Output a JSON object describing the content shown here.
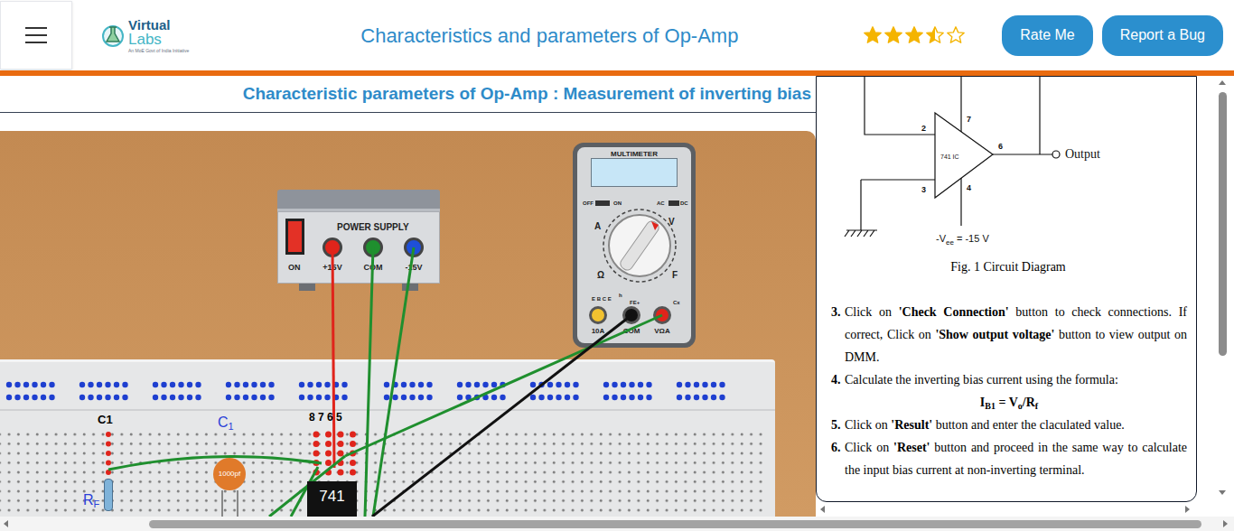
{
  "logo": {
    "word1": "Virtual",
    "word2": "Labs",
    "tagline": "An MoE Govt of India Initiative"
  },
  "title": "Characteristics and parameters of Op-Amp",
  "rating": {
    "stars": 3.5,
    "max": 5
  },
  "buttons": [
    "Rate Me",
    "Report a Bug"
  ],
  "experiment_heading": "Characteristic parameters of Op-Amp : Measurement of inverting bias",
  "power_supply": {
    "title": "POWER SUPPLY",
    "switch_label": "ON",
    "on": true,
    "terminals": [
      {
        "label": "+15V",
        "color": "#e0241b"
      },
      {
        "label": "COM",
        "color": "#1f8f2e"
      },
      {
        "label": "-15V",
        "color": "#1e4fd8"
      }
    ]
  },
  "multimeter": {
    "title": "MULTIMETER",
    "switch_labels": [
      "OFF",
      "ON",
      "AC",
      "DC"
    ],
    "dial_labels": [
      "A",
      "V",
      "Ω",
      "F"
    ],
    "socket_labels": [
      "E B C E",
      "h",
      "FE+",
      "Cx"
    ],
    "jacks": [
      {
        "label": "10A",
        "color": "#f2c230"
      },
      {
        "label": "COM",
        "color": "#111111"
      },
      {
        "label": "VΩA",
        "color": "#e0241b"
      }
    ]
  },
  "breadboard": {
    "column_label": "C1",
    "capacitor_label": {
      "text": "C",
      "sub": "1"
    },
    "pin_label": "8 7 6 5",
    "ic": "741",
    "capacitor_value": "1000pf",
    "resistor_label": {
      "text": "R",
      "sub": "F"
    }
  },
  "circuit": {
    "pins": [
      "2",
      "3",
      "7",
      "6",
      "4"
    ],
    "ic": "741 IC",
    "output": "Output",
    "supply": {
      "prefix": "-V",
      "sub": "ee",
      "suffix": " = -15 V"
    },
    "caption": "Fig. 1 Circuit Diagram"
  },
  "instructions": [
    {
      "number": "3.",
      "parts": [
        {
          "text": "Click on ",
          "bold": false
        },
        {
          "text": "'Check Connection'",
          "bold": true
        },
        {
          "text": " button to check connections. If correct, Click on ",
          "bold": false
        },
        {
          "text": "'Show output voltage'",
          "bold": true
        },
        {
          "text": " button to view output on DMM.",
          "bold": false
        }
      ],
      "formula": []
    },
    {
      "number": "4.",
      "parts": [
        {
          "text": "Calculate the inverting bias current using the formula:",
          "bold": false
        }
      ],
      "formula": [
        {
          "text": "I",
          "sub": false
        },
        {
          "text": "B1",
          "sub": true
        },
        {
          "text": " = V",
          "sub": false
        },
        {
          "text": "o",
          "sub": true
        },
        {
          "text": "/R",
          "sub": false
        },
        {
          "text": "f",
          "sub": true
        }
      ]
    },
    {
      "number": "5.",
      "parts": [
        {
          "text": "Click on ",
          "bold": false
        },
        {
          "text": "'Result'",
          "bold": true
        },
        {
          "text": " button and enter the claculated value.",
          "bold": false
        }
      ],
      "formula": []
    },
    {
      "number": "6.",
      "parts": [
        {
          "text": "Click on ",
          "bold": false
        },
        {
          "text": "'Reset'",
          "bold": true
        },
        {
          "text": " button and proceed in the same way to calculate the input bias current at non-inverting terminal.",
          "bold": false
        }
      ],
      "formula": []
    }
  ]
}
